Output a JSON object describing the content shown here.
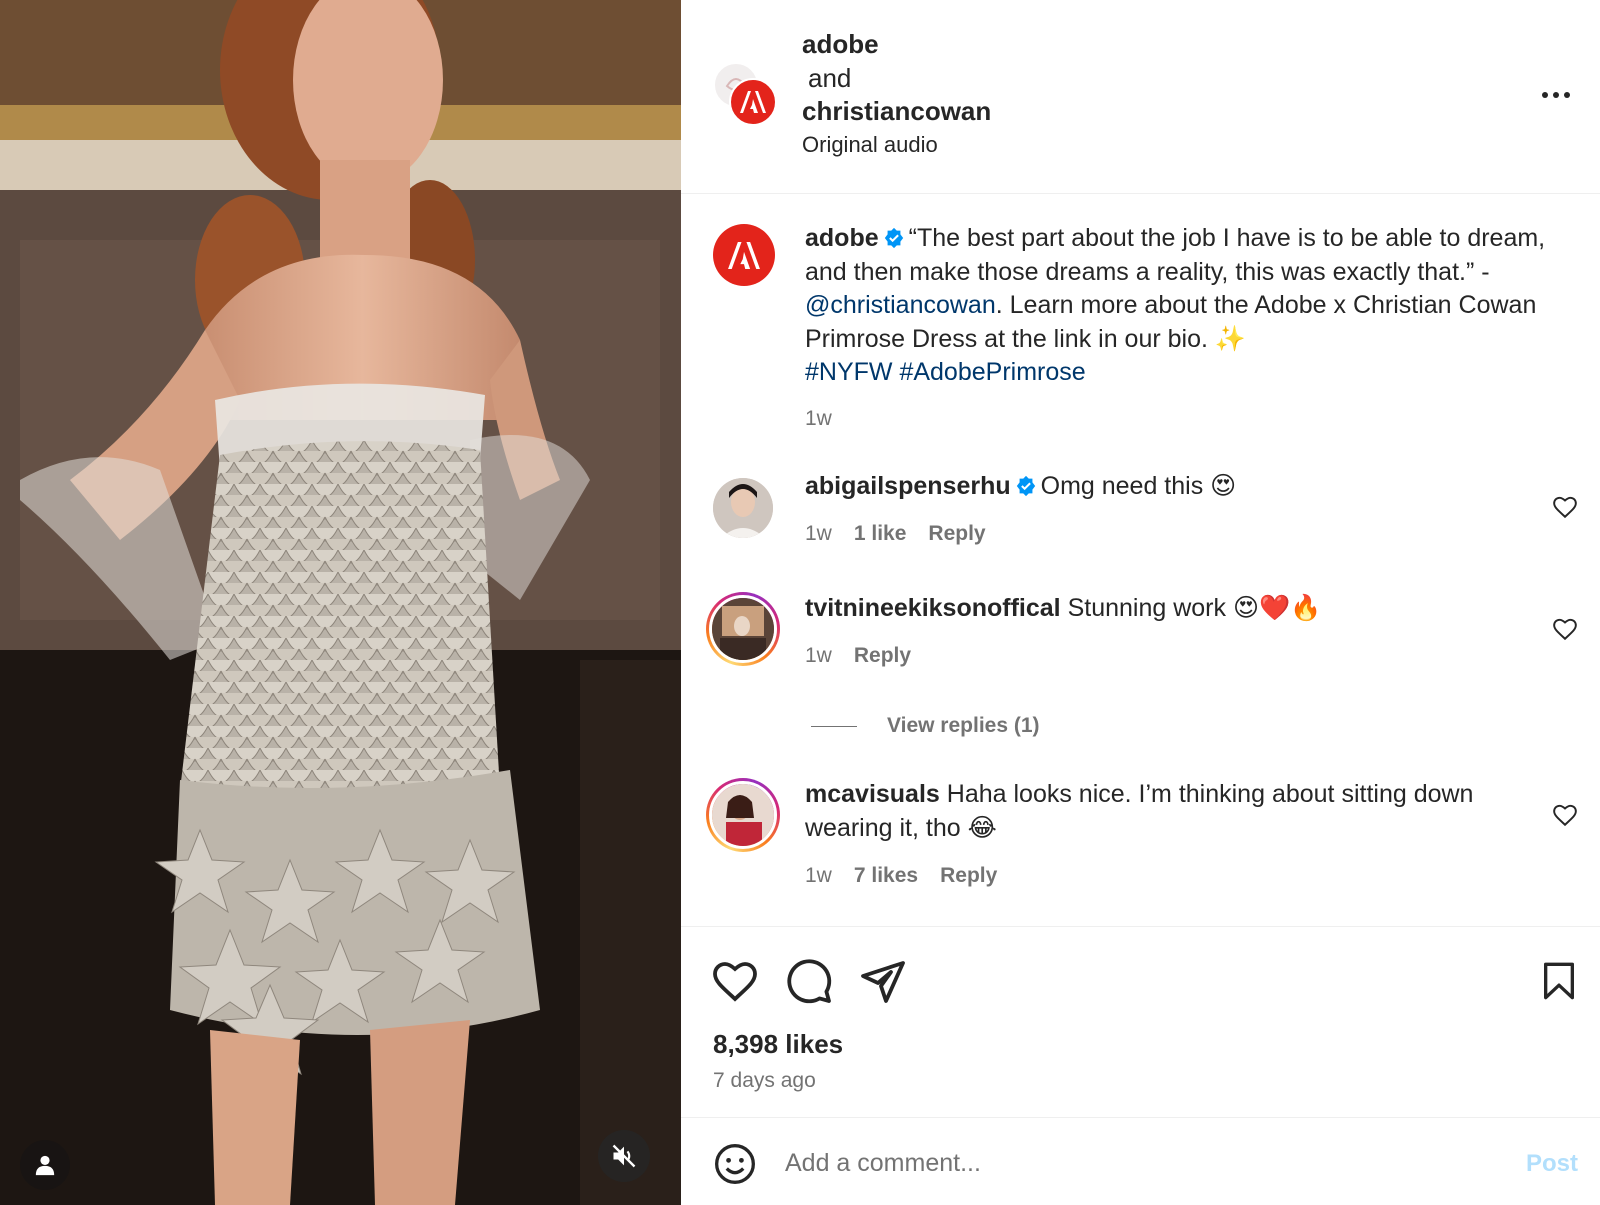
{
  "colors": {
    "accent_link": "#00376b",
    "adobe_red": "#e3241b",
    "muted": "#737373",
    "verified": "#0095f6",
    "post_disabled": "#b2dffc"
  },
  "media": {
    "user_icon": "user-icon",
    "mute_icon": "muted-speaker-icon"
  },
  "header": {
    "user1": "adobe",
    "and": "and",
    "user2": "christiancowan",
    "audio": "Original audio",
    "more_icon": "more-horizontal-icon"
  },
  "caption": {
    "username": "adobe",
    "text_part1": "“The best part about the job I have is to be able to dream, and then make those dreams a reality, this was exactly that.” - ",
    "mention": "@christiancowan",
    "text_part2": ". Learn more about the Adobe x Christian Cowan Primrose Dress at the link in our bio. ✨",
    "hashtag1": "#NYFW",
    "hashtag2": "#AdobePrimrose",
    "time": "1w"
  },
  "comments": [
    {
      "username": "abigailspenserhu",
      "verified": true,
      "text": "Omg need this 😍",
      "time": "1w",
      "likes": "1 like",
      "reply": "Reply"
    },
    {
      "username": "tvitnineekiksonoffical",
      "verified": false,
      "text": "Stunning work 😍❤️🔥",
      "time": "1w",
      "reply": "Reply",
      "view_replies": "View replies (1)"
    },
    {
      "username": "mcavisuals",
      "verified": false,
      "text": "Haha looks nice. I’m thinking about sitting down wearing it, tho 😂",
      "time": "1w",
      "likes": "7 likes",
      "reply": "Reply"
    }
  ],
  "actions": {
    "icons": [
      "heart-icon",
      "comment-icon",
      "share-icon",
      "bookmark-icon"
    ],
    "likes": "8,398 likes",
    "posted": "7 days ago"
  },
  "composer": {
    "placeholder": "Add a comment...",
    "post_label": "Post"
  }
}
